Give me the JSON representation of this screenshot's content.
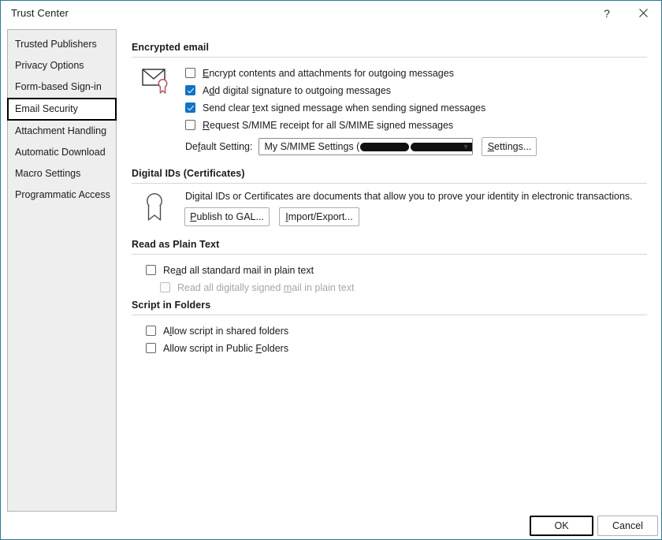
{
  "window": {
    "title": "Trust Center",
    "help_icon": "question-mark-icon",
    "close_icon": "close-icon",
    "accent_color": "#2a7b9b"
  },
  "sidebar": {
    "items": [
      {
        "label": "Trusted Publishers",
        "selected": false
      },
      {
        "label": "Privacy Options",
        "selected": false
      },
      {
        "label": "Form-based Sign-in",
        "selected": false
      },
      {
        "label": "Email Security",
        "selected": true
      },
      {
        "label": "Attachment Handling",
        "selected": false
      },
      {
        "label": "Automatic Download",
        "selected": false
      },
      {
        "label": "Macro Settings",
        "selected": false
      },
      {
        "label": "Programmatic Access",
        "selected": false
      }
    ]
  },
  "sections": {
    "encrypted_email": {
      "title": "Encrypted email",
      "icon": "envelope-certificate-icon",
      "checkboxes": [
        {
          "label_pre": "",
          "accel": "E",
          "label_post": "ncrypt contents and attachments for outgoing messages",
          "checked": false,
          "disabled": false
        },
        {
          "label_pre": "A",
          "accel": "d",
          "label_post": "d digital signature to outgoing messages",
          "checked": true,
          "disabled": false
        },
        {
          "label_pre": "Send clear ",
          "accel": "t",
          "label_post": "ext signed message when sending signed messages",
          "checked": true,
          "disabled": false
        },
        {
          "label_pre": "",
          "accel": "R",
          "label_post": "equest S/MIME receipt for all S/MIME signed messages",
          "checked": false,
          "disabled": false
        }
      ],
      "default_setting": {
        "label_pre": "De",
        "label_accel": "f",
        "label_post": "ault Setting:",
        "value_prefix": "My S/MIME Settings (",
        "value_suffix": ")",
        "value_redacted": true
      },
      "settings_button": {
        "label_pre": "",
        "accel": "S",
        "label_post": "ettings..."
      }
    },
    "digital_ids": {
      "title": "Digital IDs (Certificates)",
      "icon": "certificate-badge-icon",
      "description": "Digital IDs or Certificates are documents that allow you to prove your identity in electronic transactions.",
      "buttons": [
        {
          "label_pre": "",
          "accel": "P",
          "label_post": "ublish to GAL..."
        },
        {
          "label_pre": "",
          "accel": "I",
          "label_post": "mport/Export..."
        }
      ]
    },
    "read_as_plain_text": {
      "title": "Read as Plain Text",
      "checkboxes": [
        {
          "label_pre": "Re",
          "accel": "a",
          "label_post": "d all standard mail in plain text",
          "checked": false,
          "disabled": false
        },
        {
          "label_pre": "Read all digitally signed ",
          "accel": "m",
          "label_post": "ail in plain text",
          "checked": false,
          "disabled": true
        }
      ]
    },
    "script_in_folders": {
      "title": "Script in Folders",
      "checkboxes": [
        {
          "label_pre": "A",
          "accel": "l",
          "label_post": "low script in shared folders",
          "checked": false,
          "disabled": false
        },
        {
          "label_pre": "Allow script in Public ",
          "accel": "F",
          "label_post": "olders",
          "checked": false,
          "disabled": false
        }
      ]
    }
  },
  "footer": {
    "ok_label": "OK",
    "cancel_label": "Cancel"
  }
}
